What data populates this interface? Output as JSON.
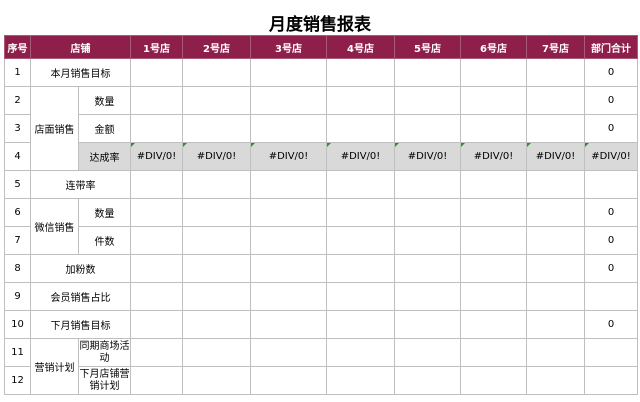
{
  "title": "月度销售报表",
  "headers": [
    "序号",
    "店铺",
    "1号店",
    "2号店",
    "3号店",
    "4号店",
    "5号店",
    "6号店",
    "7号店",
    "部门合计"
  ],
  "rows": {
    "r1": {
      "no": "1",
      "label": "本月销售目标",
      "total": "0"
    },
    "r2": {
      "no": "2",
      "group": "店面销售",
      "sub": "数量",
      "total": "0"
    },
    "r3": {
      "no": "3",
      "sub": "金额",
      "total": "0"
    },
    "r4": {
      "no": "4",
      "sub": "达成率",
      "cells": [
        "#DIV/0!",
        "#DIV/0!",
        "#DIV/0!",
        "#DIV/0!",
        "#DIV/0!",
        "#DIV/0!",
        "#DIV/0!"
      ],
      "total": "#DIV/0!"
    },
    "r5": {
      "no": "5",
      "label": "连带率"
    },
    "r6": {
      "no": "6",
      "group": "微信销售",
      "sub": "数量",
      "total": "0"
    },
    "r7": {
      "no": "7",
      "sub": "件数",
      "total": "0"
    },
    "r8": {
      "no": "8",
      "label": "加粉数",
      "total": "0"
    },
    "r9": {
      "no": "9",
      "label": "会员销售占比"
    },
    "r10": {
      "no": "10",
      "label": "下月销售目标",
      "total": "0"
    },
    "r11": {
      "no": "11",
      "group": "营销计划",
      "sub": "同期商场活动"
    },
    "r12": {
      "no": "12",
      "sub": "下月店铺营销计划"
    }
  },
  "chart_data": {
    "type": "table",
    "title": "月度销售报表",
    "columns": [
      "序号",
      "店铺",
      "1号店",
      "2号店",
      "3号店",
      "4号店",
      "5号店",
      "6号店",
      "7号店",
      "部门合计"
    ],
    "rows": [
      [
        "1",
        "本月销售目标",
        "",
        "",
        "",
        "",
        "",
        "",
        "",
        "0"
      ],
      [
        "2",
        "店面销售 / 数量",
        "",
        "",
        "",
        "",
        "",
        "",
        "",
        "0"
      ],
      [
        "3",
        "店面销售 / 金额",
        "",
        "",
        "",
        "",
        "",
        "",
        "",
        "0"
      ],
      [
        "4",
        "店面销售 / 达成率",
        "#DIV/0!",
        "#DIV/0!",
        "#DIV/0!",
        "#DIV/0!",
        "#DIV/0!",
        "#DIV/0!",
        "#DIV/0!",
        "#DIV/0!"
      ],
      [
        "5",
        "连带率",
        "",
        "",
        "",
        "",
        "",
        "",
        "",
        ""
      ],
      [
        "6",
        "微信销售 / 数量",
        "",
        "",
        "",
        "",
        "",
        "",
        "",
        "0"
      ],
      [
        "7",
        "微信销售 / 件数",
        "",
        "",
        "",
        "",
        "",
        "",
        "",
        "0"
      ],
      [
        "8",
        "加粉数",
        "",
        "",
        "",
        "",
        "",
        "",
        "",
        "0"
      ],
      [
        "9",
        "会员销售占比",
        "",
        "",
        "",
        "",
        "",
        "",
        "",
        ""
      ],
      [
        "10",
        "下月销售目标",
        "",
        "",
        "",
        "",
        "",
        "",
        "",
        "0"
      ],
      [
        "11",
        "营销计划 / 同期商场活动",
        "",
        "",
        "",
        "",
        "",
        "",
        "",
        ""
      ],
      [
        "12",
        "营销计划 / 下月店铺营销计划",
        "",
        "",
        "",
        "",
        "",
        "",
        "",
        ""
      ]
    ]
  }
}
